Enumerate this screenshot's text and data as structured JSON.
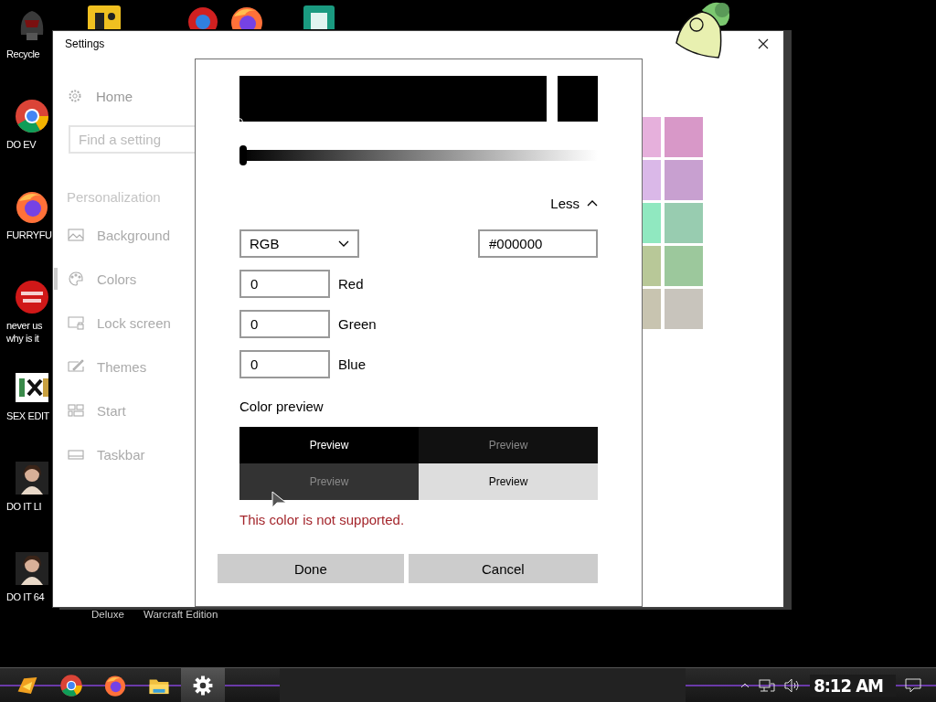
{
  "desktop": {
    "icons": [
      {
        "label": "Recycle",
        "kind": "helmet"
      },
      {
        "label": "DO EV",
        "kind": "chrome"
      },
      {
        "label": "FURRYFU",
        "kind": "firefox"
      },
      {
        "label": "never us\nwhy is it",
        "kind": "red"
      },
      {
        "label": "SEX EDIT",
        "kind": "hex"
      },
      {
        "label": "DO IT LI",
        "kind": "portrait"
      },
      {
        "label": "DO IT 64",
        "kind": "portrait"
      }
    ],
    "top_icons": [
      {
        "kind": "yellow"
      },
      {
        "kind": "ring"
      },
      {
        "kind": "firefox"
      },
      {
        "kind": "publisher"
      }
    ],
    "lower_labels": [
      "Deluxe",
      "Warcraft Edition"
    ]
  },
  "settings": {
    "title": "Settings",
    "home": "Home",
    "search": {
      "placeholder": "Find a setting"
    },
    "section": "Personalization",
    "nav": [
      {
        "label": "Background",
        "kind": "background",
        "selected": false
      },
      {
        "label": "Colors",
        "kind": "colors",
        "selected": true
      },
      {
        "label": "Lock screen",
        "kind": "lock",
        "selected": false
      },
      {
        "label": "Themes",
        "kind": "themes",
        "selected": false
      },
      {
        "label": "Start",
        "kind": "start",
        "selected": false
      },
      {
        "label": "Taskbar",
        "kind": "taskbar",
        "selected": false
      }
    ],
    "swatches": [
      {
        "color": "#e6b0dc"
      },
      {
        "color": "#d898c8"
      },
      {
        "color": "#dab8e8"
      },
      {
        "color": "#c8a0d0"
      },
      {
        "color": "#90e8c0"
      },
      {
        "color": "#98ccb0"
      },
      {
        "color": "#b8c898"
      },
      {
        "color": "#9cc89c"
      },
      {
        "color": "#c8c4b0"
      },
      {
        "color": "#c8c4bc"
      }
    ]
  },
  "dialog": {
    "slider": {
      "level": 0
    },
    "toggle": "Less",
    "mode": {
      "value": "RGB"
    },
    "hex": {
      "value": "#000000"
    },
    "channels": [
      {
        "label": "Red",
        "value": "0"
      },
      {
        "label": "Green",
        "value": "0"
      },
      {
        "label": "Blue",
        "value": "0"
      }
    ],
    "preview_heading": "Color preview",
    "previews": [
      {
        "label": "Preview",
        "color": "#000000",
        "kind": "light"
      },
      {
        "label": "Preview",
        "color": "#111111",
        "kind": "dim"
      },
      {
        "label": "Preview",
        "color": "#333333",
        "kind": "dim"
      },
      {
        "label": "Preview",
        "color": "#dddddd",
        "kind": "dark"
      }
    ],
    "error": "This color is not supported.",
    "buttons": [
      {
        "label": "Done"
      },
      {
        "label": "Cancel"
      }
    ]
  },
  "taskbar": {
    "apps": [
      {
        "kind": "start",
        "selected": false
      },
      {
        "kind": "chrome",
        "selected": false
      },
      {
        "kind": "firefox",
        "selected": false
      },
      {
        "kind": "folder",
        "selected": false
      },
      {
        "kind": "settings",
        "selected": true
      }
    ],
    "clock": "8:12 AM"
  }
}
